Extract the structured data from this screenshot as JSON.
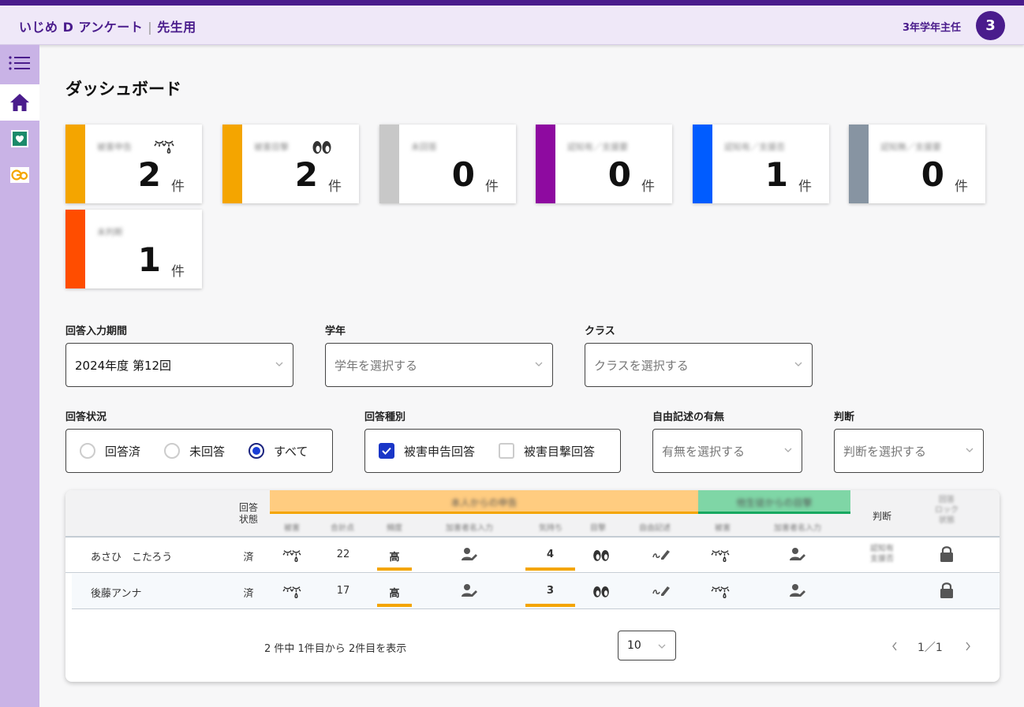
{
  "header": {
    "app_title": "いじめ D アンケート",
    "app_subtitle": "先生用",
    "user_role": "3年学年主任",
    "avatar_initial": "3"
  },
  "sidebar": {
    "items": [
      {
        "icon": "menu-list-icon",
        "active": false
      },
      {
        "icon": "home-icon",
        "active": true
      },
      {
        "icon": "heart-box-icon",
        "active": false
      },
      {
        "icon": "go-logo-icon",
        "active": false
      }
    ]
  },
  "page": {
    "title": "ダッシュボード"
  },
  "cards": [
    {
      "label": "被害申告",
      "value": "2",
      "unit": "件",
      "color": "#f4a500",
      "icon": "crying-eyes-icon"
    },
    {
      "label": "被害目撃",
      "value": "2",
      "unit": "件",
      "color": "#f4a500",
      "icon": "eyes-icon"
    },
    {
      "label": "未回答",
      "value": "0",
      "unit": "件",
      "color": "#c8c8c8"
    },
    {
      "label": "認知有／支援要",
      "value": "0",
      "unit": "件",
      "color": "#8e0aa0"
    },
    {
      "label": "認知有／支援否",
      "value": "1",
      "unit": "件",
      "color": "#005cff"
    },
    {
      "label": "認知無／支援要",
      "value": "0",
      "unit": "件",
      "color": "#8794a2"
    },
    {
      "label": "未判断",
      "value": "1",
      "unit": "件",
      "color": "#ff4d00"
    }
  ],
  "filters": {
    "period": {
      "label": "回答入力期間",
      "value": "2024年度 第12回"
    },
    "grade": {
      "label": "学年",
      "placeholder": "学年を選択する"
    },
    "class": {
      "label": "クラス",
      "placeholder": "クラスを選択する"
    },
    "status": {
      "label": "回答状況",
      "options": [
        "回答済",
        "未回答",
        "すべて"
      ],
      "selected": "すべて"
    },
    "type": {
      "label": "回答種別",
      "options": [
        "被害申告回答",
        "被害目撃回答"
      ],
      "checked": [
        "被害申告回答"
      ]
    },
    "free_text": {
      "label": "自由記述の有無",
      "placeholder": "有無を選択する"
    },
    "judgement": {
      "label": "判断",
      "placeholder": "判断を選択する"
    }
  },
  "table": {
    "headers": {
      "status": "回答\n状態",
      "group_self": "本人からの申告",
      "group_others": "他生徒からの目撃",
      "judgement": "判断",
      "lock": "回答\nロック\n状態"
    },
    "subheaders": [
      "被害",
      "合計点",
      "頻度",
      "加害者名入力",
      "気持ち",
      "目撃",
      "自由記述",
      "被害",
      "加害者名入力"
    ],
    "rows": [
      {
        "name": "あさひ　こたろう",
        "status": "済",
        "score": "22",
        "frequency": "高",
        "feeling": "4",
        "judgement": "認知有\n支援否"
      },
      {
        "name": "後藤アンナ",
        "status": "済",
        "score": "17",
        "frequency": "高",
        "feeling": "3",
        "judgement": ""
      }
    ],
    "pagination": {
      "info": "2 件中 1件目から 2件目を表示",
      "per_page": "10",
      "page": "1／1"
    }
  }
}
